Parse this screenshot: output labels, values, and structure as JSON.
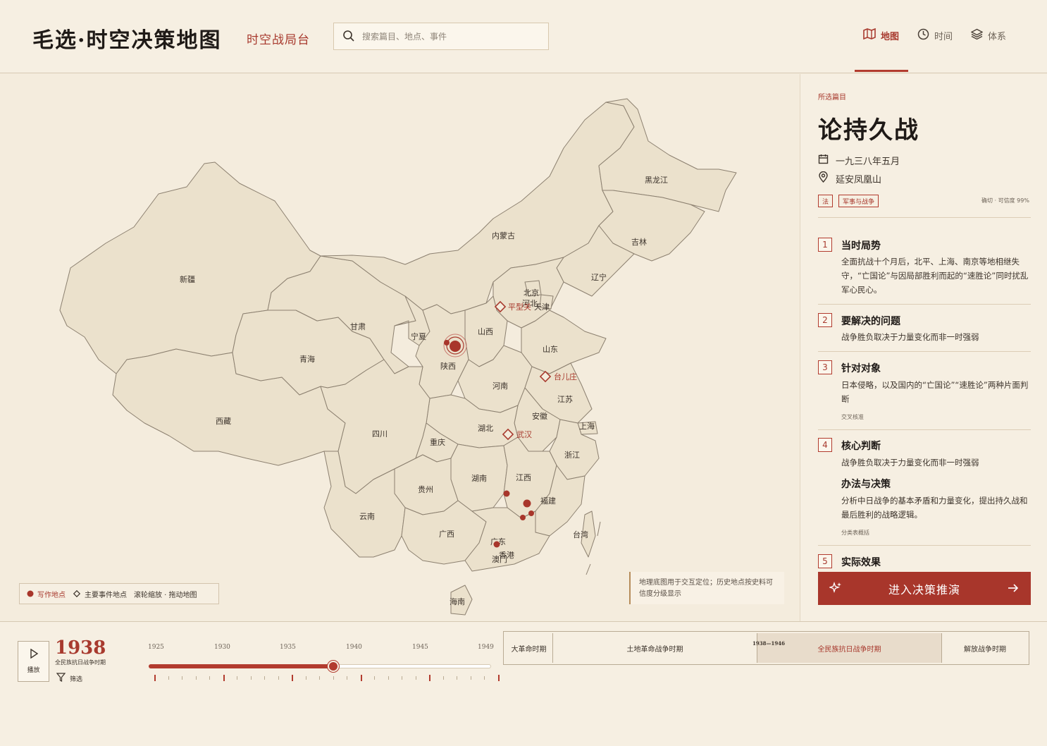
{
  "header": {
    "title": "毛选·时空决策地图",
    "subtitle": "时空战局台",
    "search_placeholder": "搜索篇目、地点、事件",
    "tabs": [
      {
        "label": "地图",
        "icon": "map-icon",
        "active": true
      },
      {
        "label": "时间",
        "icon": "clock-icon",
        "active": false
      },
      {
        "label": "体系",
        "icon": "layers-icon",
        "active": false
      }
    ]
  },
  "map": {
    "provinces": {
      "xinjiang": "新疆",
      "xizang": "西藏",
      "qinghai": "青海",
      "gansu": "甘肃",
      "neimenggu": "内蒙古",
      "heilongjiang": "黑龙江",
      "jilin": "吉林",
      "liaoning": "辽宁",
      "beijing": "北京",
      "hebei": "河北",
      "tianjin": "天津",
      "shanxi": "山西",
      "shandong": "山东",
      "ningxia": "宁夏",
      "shaanxi": "陕西",
      "henan": "河南",
      "jiangsu": "江苏",
      "anhui": "安徽",
      "shanghai": "上海",
      "hubei": "湖北",
      "sichuan": "四川",
      "chongqing": "重庆",
      "zhejiang": "浙江",
      "hunan": "湖南",
      "jiangxi": "江西",
      "fujian": "福建",
      "guizhou": "贵州",
      "yunnan": "云南",
      "guangxi": "广西",
      "guangdong": "广东",
      "hongkong": "香港",
      "macau": "澳门",
      "taiwan": "台湾",
      "hainan": "海南"
    },
    "events": {
      "pingxingguan": "平型关",
      "taierzhuang": "台儿庄",
      "wuhan": "武汉"
    },
    "legend": {
      "writing_location": "写作地点",
      "main_event": "主要事件地点",
      "hint": "滚轮缩放 · 拖动地图"
    },
    "note": "地理底图用于交互定位；历史地点按史料可信度分级显示"
  },
  "panel": {
    "section_label": "所选篇目",
    "title": "论持久战",
    "date": "一九三八年五月",
    "location": "延安凤凰山",
    "tags": [
      "法",
      "军事与战争"
    ],
    "confidence": "确切 · 可信度 99%",
    "steps": [
      {
        "num": "1",
        "title": "当时局势",
        "body": "全面抗战十个月后，北平、上海、南京等地相继失守，“亡国论”与因局部胜利而起的“速胜论”同时扰乱军心民心。"
      },
      {
        "num": "2",
        "title": "要解决的问题",
        "body": "战争胜负取决于力量变化而非一时强弱"
      },
      {
        "num": "3",
        "title": "针对对象",
        "body": "日本侵略，以及国内的“亡国论”“速胜论”两种片面判断",
        "note": "交叉核准"
      },
      {
        "num": "4",
        "title": "核心判断",
        "body": "战争胜负取决于力量变化而非一时强弱",
        "sub_title": "办法与决策",
        "sub_body": "分析中日战争的基本矛盾和力量变化，提出持久战和最后胜利的战略逻辑。",
        "note": "分类表概括"
      },
      {
        "num": "5",
        "title": "实际效果"
      }
    ],
    "cta_label": "进入决策推演"
  },
  "timeline": {
    "play_label": "播放",
    "current_year": "1938",
    "current_period": "全民族抗日战争时期",
    "filter_label": "筛选",
    "ticks": [
      "1925",
      "1930",
      "1935",
      "1940",
      "1945",
      "1949"
    ],
    "progress": 0.54,
    "periods": [
      {
        "label": "大革命时期",
        "active": false
      },
      {
        "label": "土地革命战争时期",
        "active": false
      },
      {
        "label": "全民族抗日战争时期",
        "active": true,
        "range": "1938—1946"
      },
      {
        "label": "解放战争时期",
        "active": false
      }
    ]
  },
  "colors": {
    "accent": "#a8362b",
    "background": "#f4ecdd",
    "province_fill": "#ebe1cc",
    "province_stroke": "#8c8070"
  }
}
